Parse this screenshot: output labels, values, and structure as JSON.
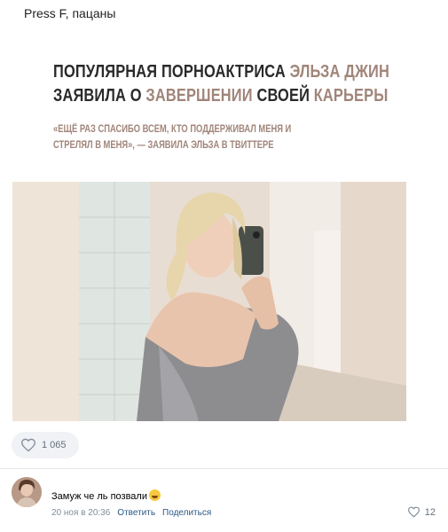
{
  "post": {
    "group_name": "Press F, пацаны",
    "headline": {
      "line1_a": "ПОПУЛЯРНАЯ ПОРНОАКТРИСА ",
      "line1_b": "ЭЛЬЗА ДЖИН",
      "line2_a": "ЗАЯВИЛА О ",
      "line2_b": "ЗАВЕРШЕНИИ",
      "line2_c": " СВОЕЙ ",
      "line2_d": "КАРЬЕРЫ"
    },
    "quote": {
      "line1": "«ЕЩЁ РАЗ СПАСИБО ВСЕМ, КТО ПОДДЕРЖИВАЛ МЕНЯ И",
      "line2": "СТРЕЛЯЛ В МЕНЯ», — ЗАЯВИЛА ЭЛЬЗА В ТВИТТЕРЕ"
    },
    "likes": "1 065"
  },
  "comment": {
    "text": "Замуж че ль позвали",
    "date": "20 ноя в 20:36",
    "reply_label": "Ответить",
    "share_label": "Поделиться",
    "likes": "12"
  },
  "icons": {
    "like": "heart-icon",
    "emoji": "laughing-emoji-icon"
  },
  "colors": {
    "accent_text": "#a0857a",
    "link": "#2a5885",
    "meta": "#818c99"
  }
}
